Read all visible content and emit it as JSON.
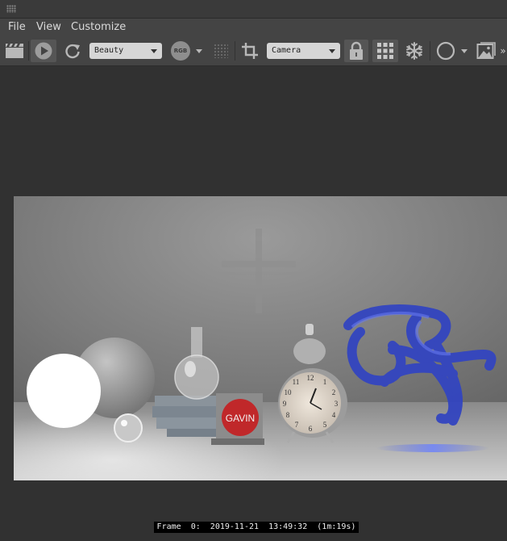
{
  "menu": {
    "file": "File",
    "view": "View",
    "customize": "Customize"
  },
  "toolbar": {
    "pass_dropdown": "Beauty",
    "rgb_badge": "RGB",
    "camera_dropdown": "Camera",
    "overflow": "»"
  },
  "render": {
    "sign_text": "GAVIN"
  },
  "status": {
    "frame_label": "Frame",
    "frame_number": "0:",
    "date": "2019-11-21",
    "time": "13:49:32",
    "duration": "(1m:19s)"
  }
}
